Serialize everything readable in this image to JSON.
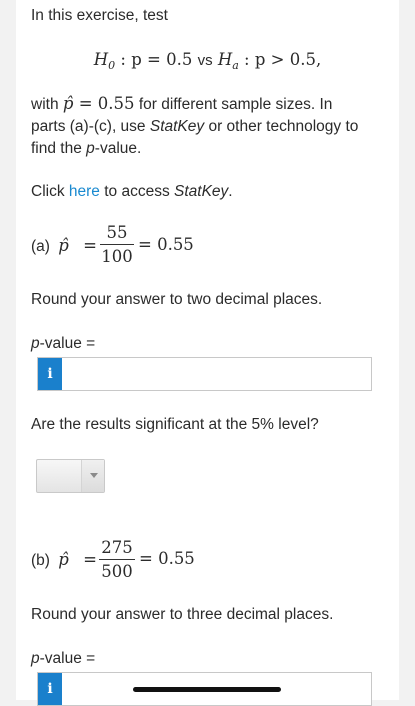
{
  "intro": {
    "line1": "In this exercise, test",
    "hypothesis": {
      "h0_left": "H",
      "h0_sub": "0",
      "h0_rest": " : p = 0.5 ",
      "vs": "vs",
      "ha_left": " H",
      "ha_sub": "a",
      "ha_rest": " : p > 0.5,"
    },
    "with_text": "with",
    "phat_symbol": "p̂",
    "with_value": " = 0.55",
    "line2_rest": " for different sample sizes. In",
    "line3_a": "parts (a)-(c), use ",
    "line3_statkey": "StatKey",
    "line3_b": " or other technology to",
    "line4_a": "find the ",
    "line4_p": "p",
    "line4_b": "-value."
  },
  "click_line": {
    "prefix": "Click ",
    "link": "here",
    "middle": " to access ",
    "statkey": "StatKey",
    "suffix": "."
  },
  "part_a": {
    "label": "(a)",
    "phat_symbol": "p̂",
    "equals": "=",
    "numerator": "55",
    "denominator": "100",
    "result": "= 0.55",
    "round_instruction": "Round your answer to two decimal places.",
    "pvalue_p": "p",
    "pvalue_label": "-value =",
    "info_icon": "i",
    "answer_value": "",
    "significance_question": "Are the results significant at the 5% level?",
    "dropdown_selected": ""
  },
  "part_b": {
    "label": "(b)",
    "phat_symbol": "p̂",
    "equals": "=",
    "numerator": "275",
    "denominator": "500",
    "result": "= 0.55",
    "round_instruction": "Round your answer to three decimal places.",
    "pvalue_p": "p",
    "pvalue_label": "-value =",
    "info_icon": "i"
  },
  "colors": {
    "link": "#1a8ad0",
    "info_button": "#1a80cc",
    "background": "#f2f2f2"
  }
}
